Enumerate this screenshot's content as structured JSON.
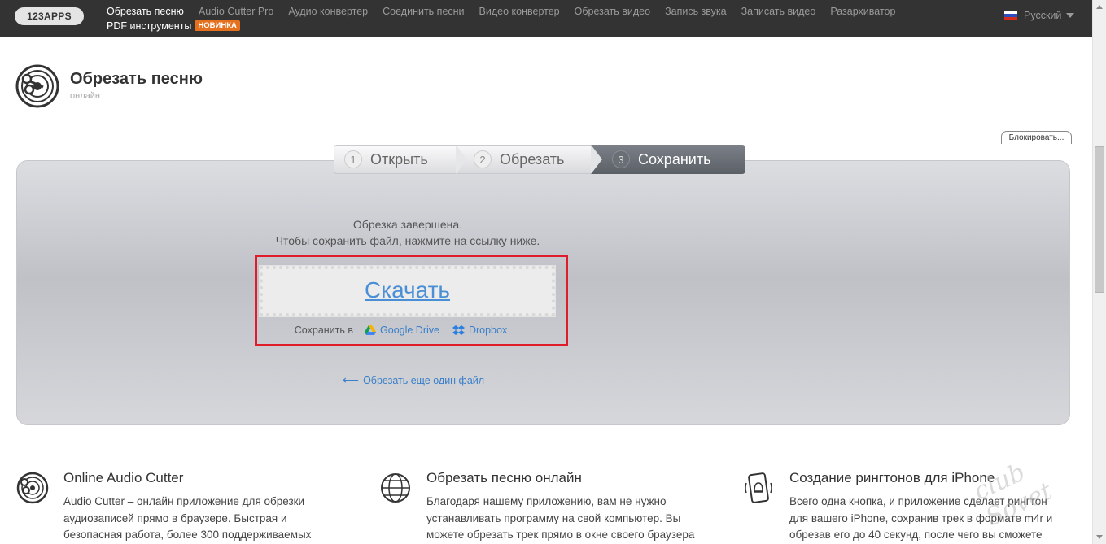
{
  "topbar": {
    "logo": "123APPS",
    "nav_row1": [
      "Обрезать песню",
      "Audio Cutter Pro",
      "Аудио конвертер",
      "Соединить песни",
      "Видео конвертер",
      "Обрезать видео",
      "Запись звука",
      "Записать видео",
      "Разархиватор"
    ],
    "pdf": "PDF инструменты",
    "badge": "НОВИНКА",
    "language": "Русский"
  },
  "header": {
    "title": "Обрезать песню",
    "subtitle": "онлайн"
  },
  "block_button": "Блокировать...",
  "steps": [
    {
      "num": "1",
      "label": "Открыть"
    },
    {
      "num": "2",
      "label": "Обрезать"
    },
    {
      "num": "3",
      "label": "Сохранить"
    }
  ],
  "result": {
    "line1": "Обрезка завершена.",
    "line2": "Чтобы сохранить файл, нажмите на ссылку ниже.",
    "download": "Скачать",
    "save_to_label": "Сохранить в",
    "google_drive": "Google Drive",
    "dropbox": "Dropbox",
    "again_arrow": "⟵",
    "again": "Обрезать еще один файл"
  },
  "features": [
    {
      "title": "Online Audio Cutter",
      "text": "Audio Cutter – онлайн приложение для обрезки аудиозаписей прямо в браузере. Быстрая и безопасная работа, более 300 поддерживаемых"
    },
    {
      "title": "Обрезать песню онлайн",
      "text": "Благодаря нашему приложению, вам не нужно устанавливать программу на свой компьютер. Вы можете обрезать трек прямо в окне своего браузера"
    },
    {
      "title": "Создание рингтонов для iPhone",
      "text": "Всего одна кнопка, и приложение сделает рингтон для вашего iPhone, сохранив трек в формате m4r и обрезав его до 40 секунд, после чего вы сможете"
    }
  ],
  "watermark": "club Sovet",
  "colors": {
    "topbar": "#333333",
    "accent_link": "#3a7fc8",
    "highlight": "#e01b2a",
    "badge": "#e5701e"
  }
}
